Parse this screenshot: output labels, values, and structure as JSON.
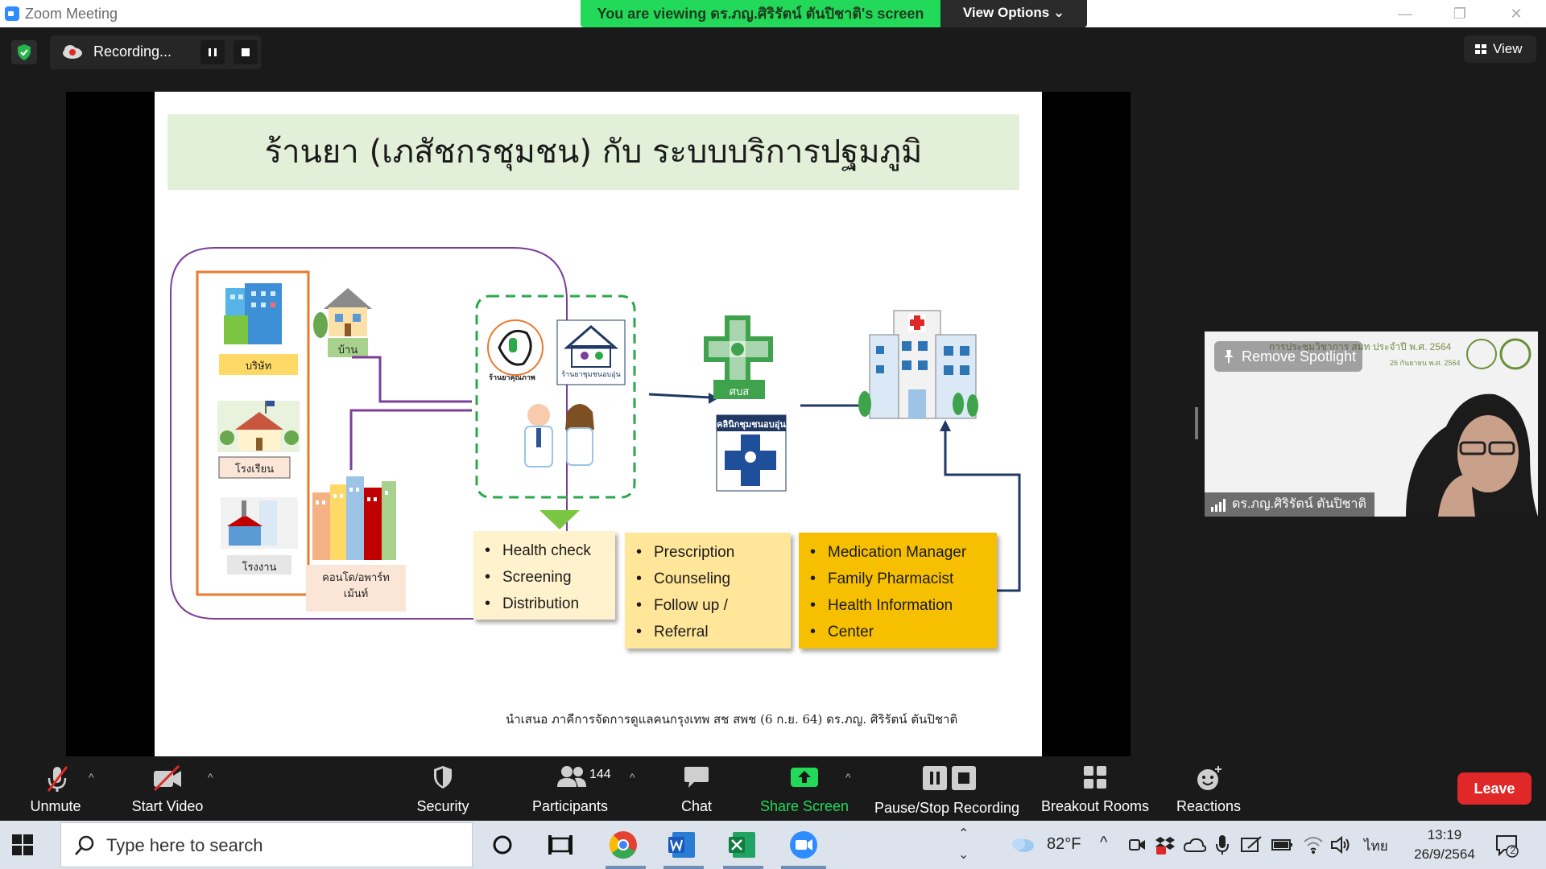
{
  "window": {
    "title": "Zoom Meeting",
    "viewing_banner": "You are viewing ดร.ภญ.ศิริรัตน์ ตันปิชาติ's screen",
    "view_options": "View Options ⌄",
    "minimize": "—",
    "restore": "❐",
    "close": "✕"
  },
  "recording": {
    "label": "Recording..."
  },
  "view_button": "View",
  "slide": {
    "title": "ร้านยา (เภสัชกรชุมชน) กับ ระบบบริการปฐมภูมิ",
    "labels": {
      "company": "บริษัท",
      "home": "บ้าน",
      "school": "โรงเรียน",
      "factory": "โรงงาน",
      "condo": "คอนโด/อพาร์ท เม้นท์",
      "pharmacy_logo": "ร้านยาคุณภาพ",
      "warm_pharmacy_logo": "ร้านยาชุมชนอบอุ่น",
      "phc": "ศบส",
      "warm_clinic": "คลินิกชุมชนอบอุ่น"
    },
    "box1": [
      "Health check",
      "Screening",
      "Distribution"
    ],
    "box2": [
      "Prescription",
      "Counseling",
      "Follow up /",
      "Referral"
    ],
    "box3": [
      "Medication Manager",
      "Family Pharmacist",
      "Health Information",
      "Center"
    ],
    "footer": "นำเสนอ ภาคีการจัดการดูแลคนกรุงเทพ สช สพช (6 ก.ย. 64)      ดร.ภญ. ศิริรัตน์ ตันปิชาติ",
    "colors": {
      "title_bg": "#e2f0d9",
      "purple": "#7b3f98",
      "orange": "#e97a2e",
      "navy": "#1f3864",
      "green_dash": "#2aa84a",
      "box1_bg": "#fff2cc",
      "box2_bg": "#ffe699",
      "box3_bg": "#f6c000"
    }
  },
  "video_tile": {
    "header": "การประชุมวิชาการ สมท ประจำปี พ.ศ. 2564",
    "subheader": "26 กันยายน พ.ศ. 2564",
    "spotlight": "Remove Spotlight",
    "name": "ดร.ภญ.ศิริรัตน์ ตันปิชาติ"
  },
  "toolbar": {
    "unmute": "Unmute",
    "start_video": "Start Video",
    "security": "Security",
    "participants": "Participants",
    "participants_count": "144",
    "chat": "Chat",
    "share_screen": "Share Screen",
    "pause_stop": "Pause/Stop Recording",
    "breakout": "Breakout Rooms",
    "reactions": "Reactions",
    "leave": "Leave",
    "share_color": "#23d959",
    "leave_color": "#e02828"
  },
  "taskbar": {
    "search_placeholder": "Type here to search",
    "weather": "82°F",
    "language": "ไทย",
    "time": "13:19",
    "date": "26/9/2564",
    "notification_count": "2"
  }
}
